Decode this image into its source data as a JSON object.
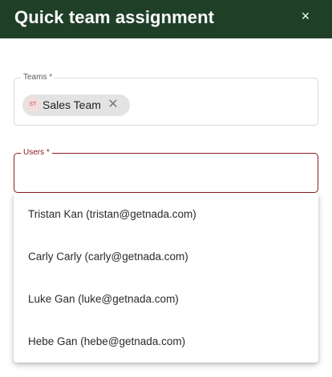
{
  "dialog": {
    "title": "Quick team assignment",
    "close_icon": "×"
  },
  "teams_field": {
    "label": "Teams *",
    "chip": {
      "avatar_text": "ST",
      "label": "Sales Team",
      "remove_icon": "✕"
    }
  },
  "users_field": {
    "label": "Users *",
    "value": "",
    "placeholder": ""
  },
  "user_options": [
    {
      "label": "Tristan Kan (tristan@getnada.com)"
    },
    {
      "label": "Carly Carly (carly@getnada.com)"
    },
    {
      "label": "Luke Gan (luke@getnada.com)"
    },
    {
      "label": "Hebe Gan (hebe@getnada.com)"
    }
  ],
  "colors": {
    "header_bg": "#1f3f27",
    "error_accent": "#8b1d22"
  }
}
